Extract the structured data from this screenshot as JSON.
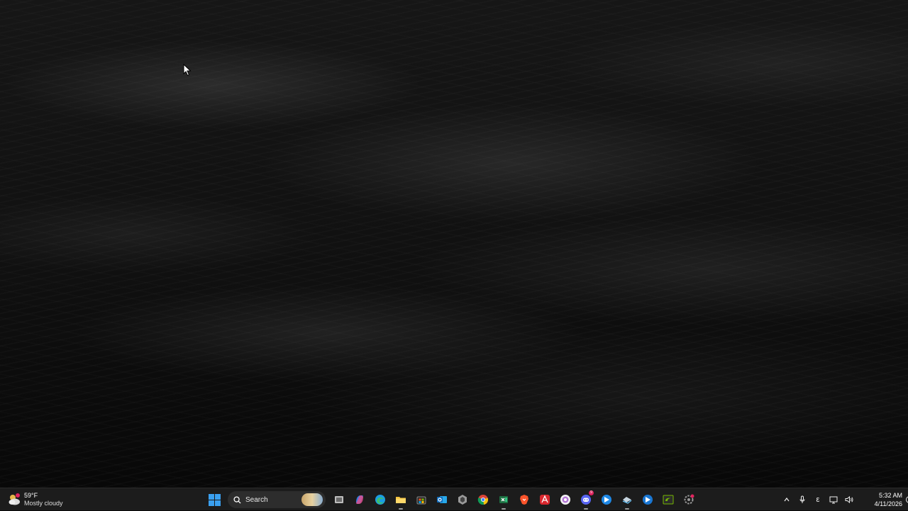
{
  "desktop": {
    "wallpaper": "dark-ocean-waves"
  },
  "weather": {
    "temperature": "59°F",
    "condition": "Mostly cloudy",
    "icon": "cloudy-weather-icon"
  },
  "taskbar": {
    "search_placeholder": "Search",
    "apps": [
      {
        "name": "start",
        "icon": "windows-logo-icon"
      },
      {
        "name": "task-view",
        "icon": "task-view-icon"
      },
      {
        "name": "copilot",
        "icon": "copilot-icon"
      },
      {
        "name": "edge",
        "icon": "edge-icon"
      },
      {
        "name": "file-explorer",
        "icon": "folder-icon"
      },
      {
        "name": "microsoft-store",
        "icon": "store-icon"
      },
      {
        "name": "outlook",
        "icon": "outlook-icon"
      },
      {
        "name": "app-hexagon",
        "icon": "hexagon-icon"
      },
      {
        "name": "chrome",
        "icon": "chrome-icon"
      },
      {
        "name": "excel",
        "icon": "excel-icon"
      },
      {
        "name": "brave",
        "icon": "brave-icon"
      },
      {
        "name": "adobe-acrobat",
        "icon": "acrobat-icon"
      },
      {
        "name": "app-round",
        "icon": "round-app-icon"
      },
      {
        "name": "discord",
        "icon": "discord-icon",
        "badge": "9"
      },
      {
        "name": "app-arrow-1",
        "icon": "blue-arrow-app-icon"
      },
      {
        "name": "steam",
        "icon": "steam-icon"
      },
      {
        "name": "app-arrow-2",
        "icon": "blue-arrow-app-icon"
      },
      {
        "name": "nvidia",
        "icon": "nvidia-icon"
      },
      {
        "name": "app-red-dot",
        "icon": "settings-app-icon"
      }
    ]
  },
  "tray": {
    "language": "ε",
    "time": "5:32 AM",
    "date": "4/11/2026"
  },
  "colors": {
    "taskbar_bg": "#1c1c1c",
    "accent": "#3aa0f0"
  }
}
